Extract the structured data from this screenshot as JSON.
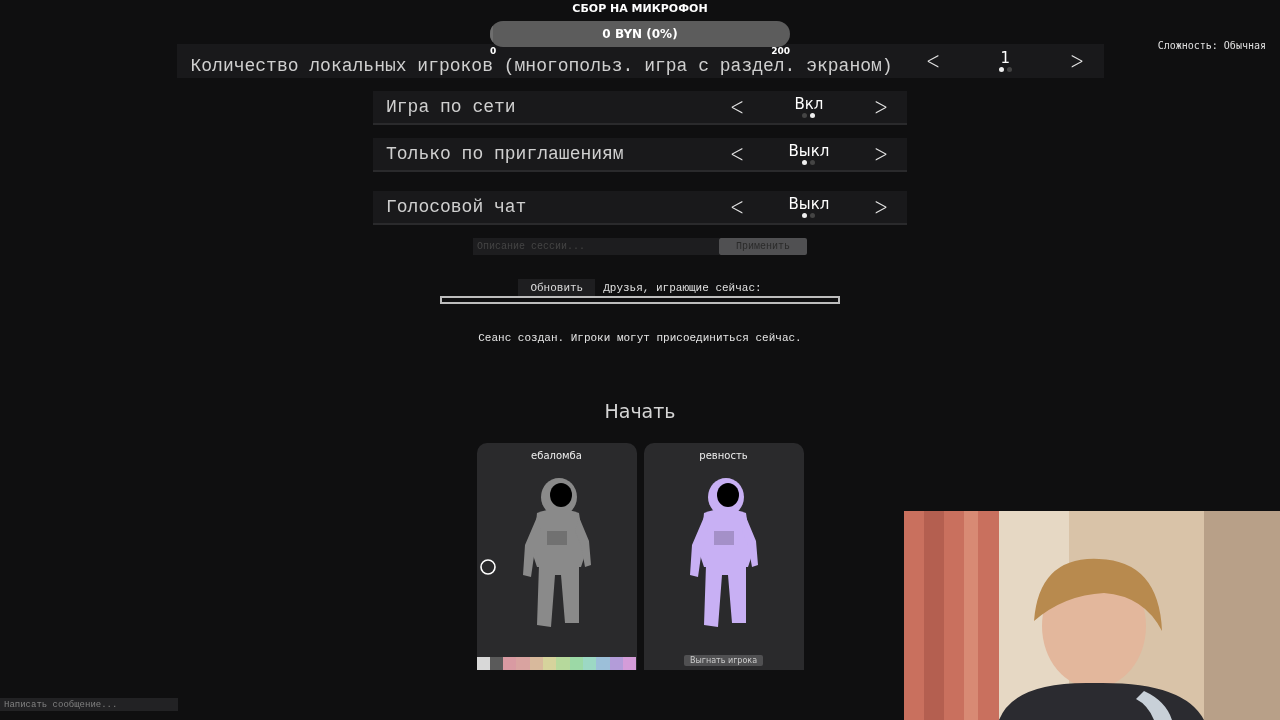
{
  "donation": {
    "title": "СБОР НА МИКРОФОН",
    "amount": "0 BYN (0%)",
    "level": 0,
    "min": "0",
    "max": "200"
  },
  "difficulty": "Сложность: Обычная",
  "player_count": {
    "label": "Количество локальных игроков (многопольз. игра с раздел. экраном)",
    "prev": "<",
    "value": "1",
    "next": ">",
    "dots": [
      {
        "selected": true
      },
      {
        "selected": false
      }
    ]
  },
  "options": [
    {
      "label": "Игра по сети",
      "prev": "<",
      "value": "Вкл",
      "next": ">",
      "dots": [
        {
          "selected": false
        },
        {
          "selected": true
        }
      ]
    },
    {
      "label": "Только по приглашениям",
      "prev": "<",
      "value": "Выкл",
      "next": ">",
      "dots": [
        {
          "selected": true
        },
        {
          "selected": false
        }
      ]
    },
    {
      "label": "Голосовой чат",
      "prev": "<",
      "value": "Выкл",
      "next": ">",
      "dots": [
        {
          "selected": true
        },
        {
          "selected": false
        }
      ]
    }
  ],
  "session": {
    "placeholder": "Описание сессии...",
    "apply": "Применить"
  },
  "friends": {
    "refresh": "Обновить",
    "label": "Друзья, играющие сейчас:"
  },
  "status": "Сеанс создан. Игроки могут присоединиться сейчас.",
  "start": "Начать",
  "players": [
    {
      "name": "ебаломба",
      "color": "#8a8a8a",
      "palette": [
        {
          "color": "#d8d8d8"
        },
        {
          "color": "#5a5a5a"
        },
        {
          "color": "#d99aa2"
        },
        {
          "color": "#d9a3a0"
        },
        {
          "color": "#d8b99c"
        },
        {
          "color": "#d6d39c"
        },
        {
          "color": "#b6d99c"
        },
        {
          "color": "#9cd9a6"
        },
        {
          "color": "#9cd8c4"
        },
        {
          "color": "#9cbfd9"
        },
        {
          "color": "#b39cd9"
        },
        {
          "color": "#d49cd9"
        }
      ]
    },
    {
      "name": "ревность",
      "color": "#c8b0f4",
      "kick": "Выгнать игрока"
    }
  ],
  "chat": {
    "placeholder": "Написать сообщение..."
  }
}
